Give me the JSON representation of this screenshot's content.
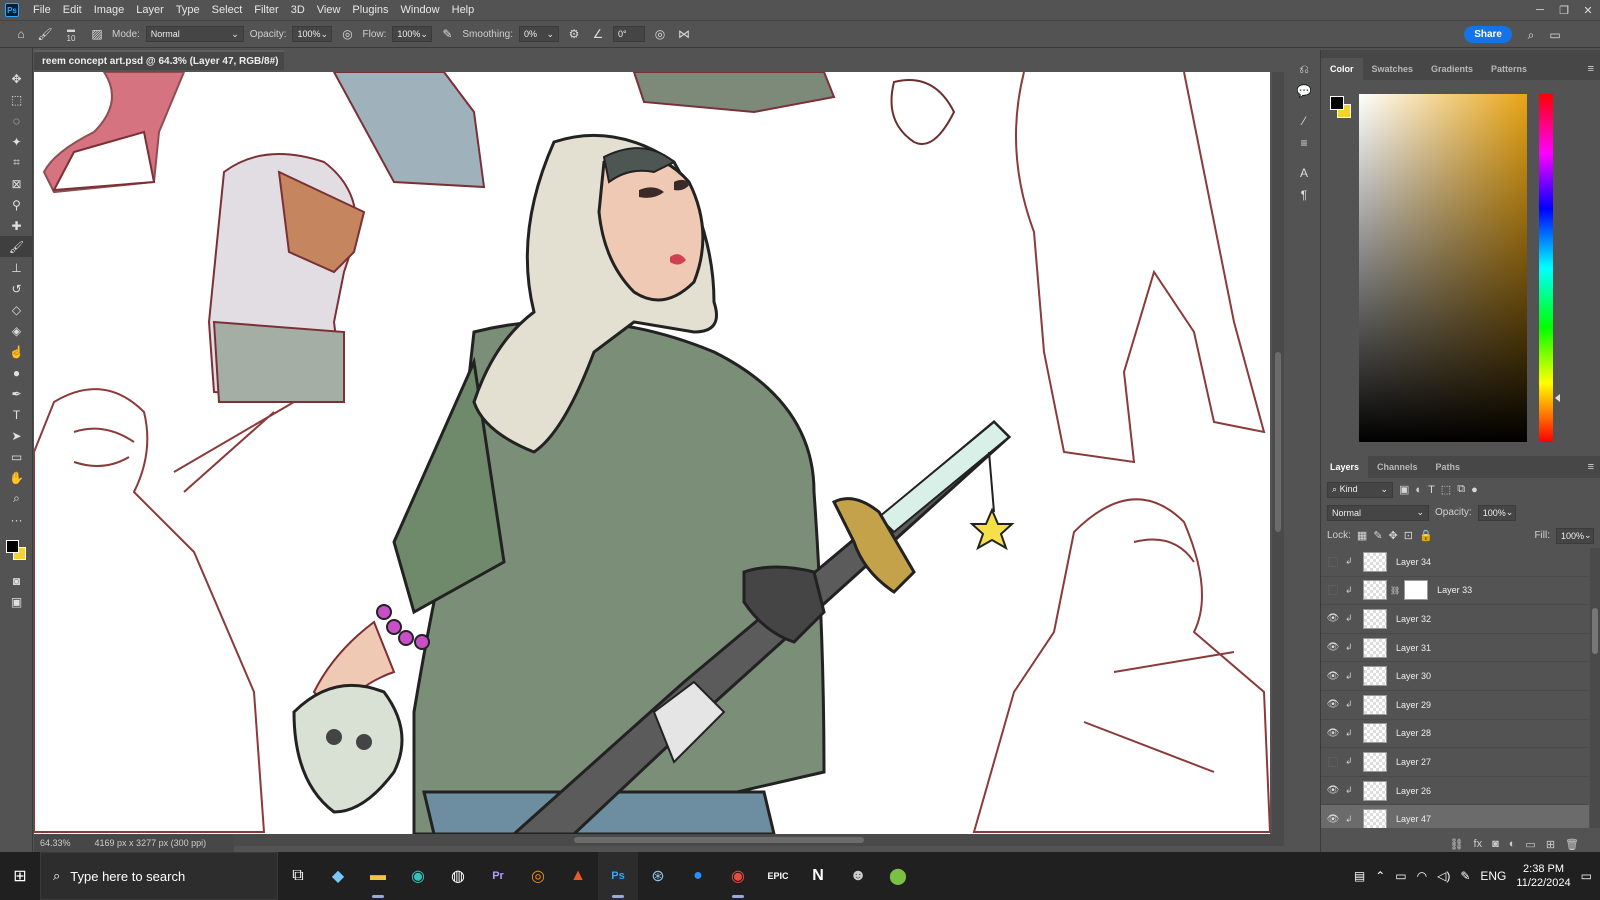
{
  "app": {
    "logo": "Ps",
    "menu": [
      "File",
      "Edit",
      "Image",
      "Layer",
      "Type",
      "Select",
      "Filter",
      "3D",
      "View",
      "Plugins",
      "Window",
      "Help"
    ]
  },
  "options_bar": {
    "brush_size": "10",
    "mode_label": "Mode:",
    "mode_value": "Normal",
    "opacity_label": "Opacity:",
    "opacity_value": "100%",
    "flow_label": "Flow:",
    "flow_value": "100%",
    "smoothing_label": "Smoothing:",
    "smoothing_value": "0%",
    "angle_value": "0°",
    "share_label": "Share"
  },
  "document": {
    "tab_title": "reem concept art.psd @ 64.3% (Layer 47, RGB/8#) *",
    "zoom": "64.33%",
    "dimensions": "4169 px x 3277 px (300 ppi)"
  },
  "color_panel": {
    "tabs": [
      "Color",
      "Swatches",
      "Gradients",
      "Patterns"
    ],
    "foreground": "#000000",
    "background": "#f5d132"
  },
  "layers_panel": {
    "tabs": [
      "Layers",
      "Channels",
      "Paths"
    ],
    "filter_kind": "Kind",
    "blend_mode": "Normal",
    "opacity_label": "Opacity:",
    "opacity_value": "100%",
    "lock_label": "Lock:",
    "fill_label": "Fill:",
    "fill_value": "100%",
    "layers": [
      {
        "name": "Layer 34",
        "visible": false
      },
      {
        "name": "Layer 33",
        "visible": false
      },
      {
        "name": "Layer 32",
        "visible": true
      },
      {
        "name": "Layer 31",
        "visible": true
      },
      {
        "name": "Layer 30",
        "visible": true
      },
      {
        "name": "Layer 29",
        "visible": true
      },
      {
        "name": "Layer 28",
        "visible": true
      },
      {
        "name": "Layer 27",
        "visible": false
      },
      {
        "name": "Layer 26",
        "visible": true
      },
      {
        "name": "Layer 47",
        "visible": true
      }
    ]
  },
  "taskbar": {
    "search_placeholder": "Type here to search",
    "language": "ENG",
    "time": "2:38 PM",
    "date": "11/22/2024"
  }
}
